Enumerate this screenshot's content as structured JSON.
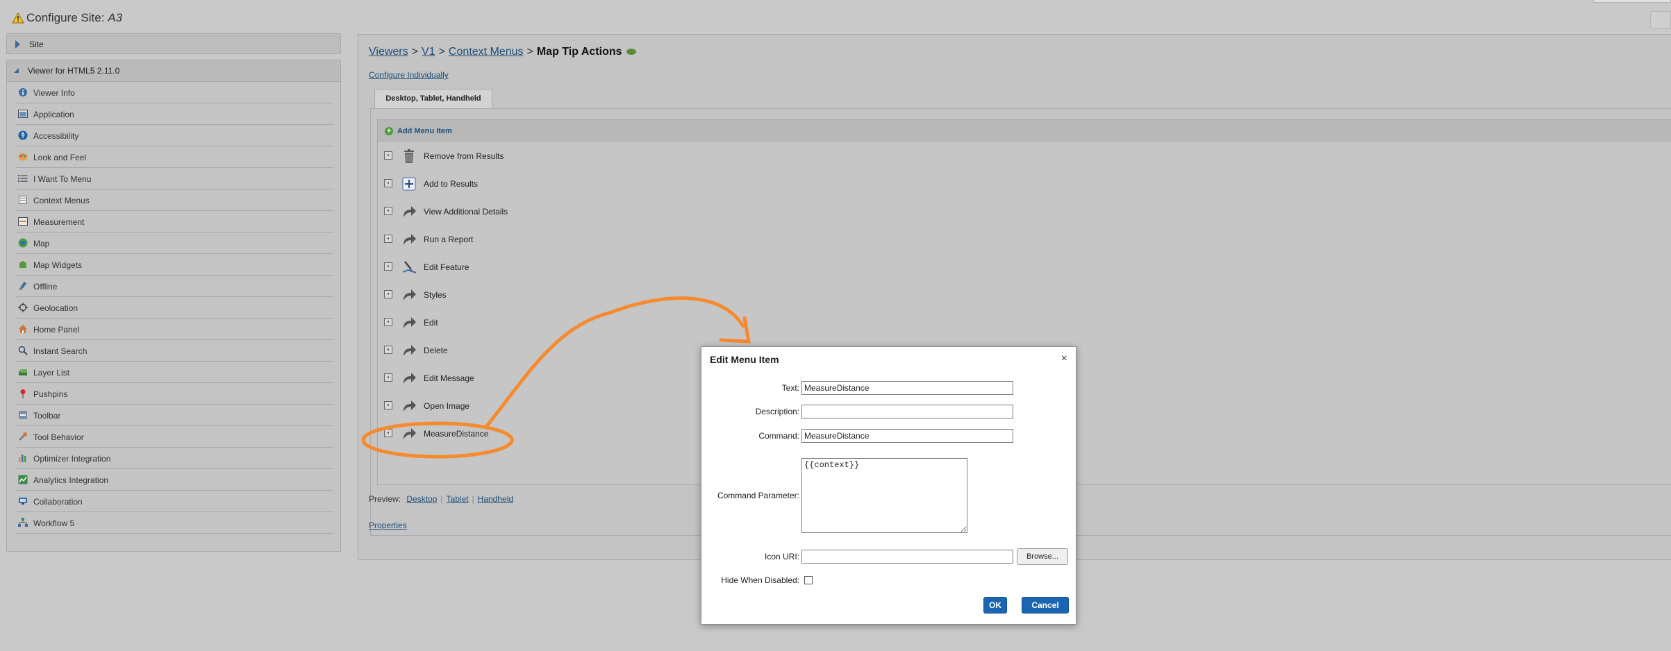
{
  "window": {
    "title_prefix": "Configure Site: ",
    "title_site": "A3"
  },
  "sidebar": {
    "site_label": "Site",
    "viewer_label": "Viewer for HTML5 2.11.0",
    "items": [
      {
        "label": "Viewer Info",
        "icon": "info-icon"
      },
      {
        "label": "Application",
        "icon": "application-icon"
      },
      {
        "label": "Accessibility",
        "icon": "accessibility-icon"
      },
      {
        "label": "Look and Feel",
        "icon": "palette-icon"
      },
      {
        "label": "I Want To Menu",
        "icon": "list-icon"
      },
      {
        "label": "Context Menus",
        "icon": "context-menu-icon"
      },
      {
        "label": "Measurement",
        "icon": "ruler-icon"
      },
      {
        "label": "Map",
        "icon": "globe-icon"
      },
      {
        "label": "Map Widgets",
        "icon": "puzzle-icon"
      },
      {
        "label": "Offline",
        "icon": "offline-icon"
      },
      {
        "label": "Geolocation",
        "icon": "crosshair-icon"
      },
      {
        "label": "Home Panel",
        "icon": "home-icon"
      },
      {
        "label": "Instant Search",
        "icon": "search-icon"
      },
      {
        "label": "Layer List",
        "icon": "layers-icon"
      },
      {
        "label": "Pushpins",
        "icon": "pushpin-icon"
      },
      {
        "label": "Toolbar",
        "icon": "toolbar-icon"
      },
      {
        "label": "Tool Behavior",
        "icon": "wrench-icon"
      },
      {
        "label": "Optimizer Integration",
        "icon": "bar-chart-icon"
      },
      {
        "label": "Analytics Integration",
        "icon": "analytics-icon"
      },
      {
        "label": "Collaboration",
        "icon": "collaboration-icon"
      },
      {
        "label": "Workflow 5",
        "icon": "workflow-icon"
      }
    ]
  },
  "main": {
    "breadcrumb": {
      "viewers": "Viewers",
      "v1": "V1",
      "context_menus": "Context Menus",
      "current": "Map Tip Actions",
      "separator": ">"
    },
    "configure_link": "Configure Individually",
    "tab_label": "Desktop, Tablet, Handheld",
    "add_menu_item": "Add Menu Item",
    "menu_items": [
      {
        "label": "Remove from Results",
        "icon": "trash-icon"
      },
      {
        "label": "Add to Results",
        "icon": "add-icon"
      },
      {
        "label": "View Additional Details",
        "icon": "arrow-icon"
      },
      {
        "label": "Run a Report",
        "icon": "arrow-icon"
      },
      {
        "label": "Edit Feature",
        "icon": "edit-feature-icon"
      },
      {
        "label": "Styles",
        "icon": "arrow-icon"
      },
      {
        "label": "Edit",
        "icon": "arrow-icon"
      },
      {
        "label": "Delete",
        "icon": "arrow-icon"
      },
      {
        "label": "Edit Message",
        "icon": "arrow-icon"
      },
      {
        "label": "Open Image",
        "icon": "arrow-icon"
      },
      {
        "label": "MeasureDistance",
        "icon": "arrow-icon"
      }
    ],
    "preview": {
      "label": "Preview:",
      "desktop": "Desktop",
      "tablet": "Tablet",
      "handheld": "Handheld"
    },
    "properties_link": "Properties"
  },
  "dialog": {
    "title": "Edit Menu Item",
    "close": "×",
    "text_label": "Text:",
    "text_value": "MeasureDistance",
    "description_label": "Description:",
    "description_value": "",
    "command_label": "Command:",
    "command_value": "MeasureDistance",
    "command_parameter_label": "Command Parameter:",
    "command_parameter_value": "{{context}}",
    "icon_uri_label": "Icon URI:",
    "icon_uri_value": "",
    "browse_label": "Browse...",
    "hide_when_disabled_label": "Hide When Disabled:",
    "hide_when_disabled": false,
    "ok_label": "OK",
    "cancel_label": "Cancel"
  },
  "colors": {
    "annotation": "#f58a2e",
    "link": "#1e4f7a",
    "primary_button": "#1b66b3"
  }
}
